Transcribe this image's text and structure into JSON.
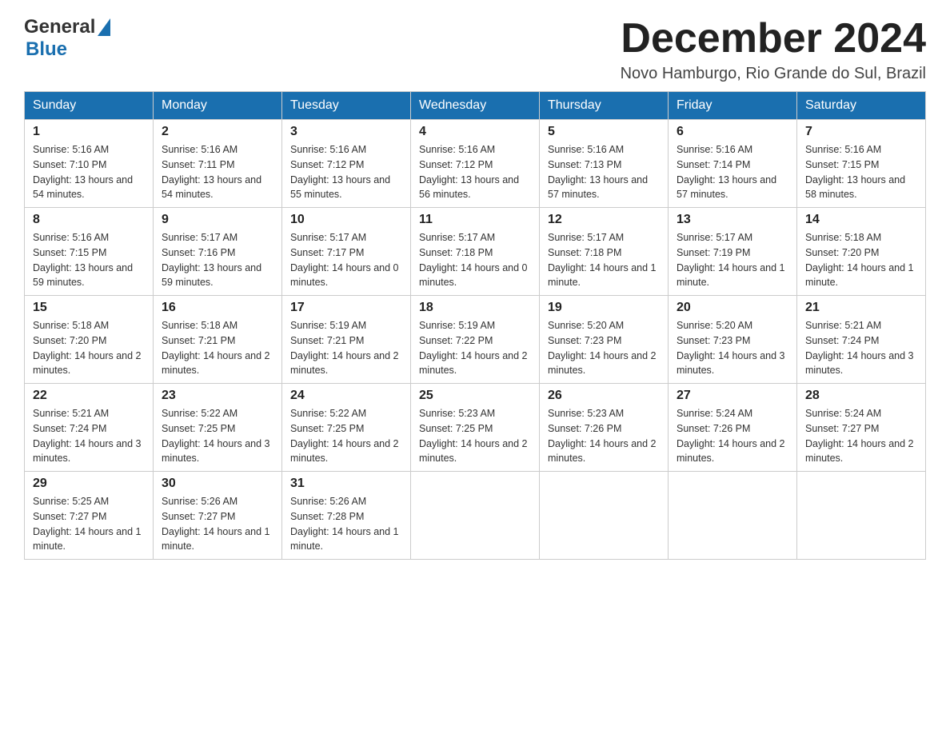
{
  "logo": {
    "text_general": "General",
    "text_blue": "Blue",
    "aria": "GeneralBlue logo"
  },
  "header": {
    "month_year": "December 2024",
    "location": "Novo Hamburgo, Rio Grande do Sul, Brazil"
  },
  "days_of_week": [
    "Sunday",
    "Monday",
    "Tuesday",
    "Wednesday",
    "Thursday",
    "Friday",
    "Saturday"
  ],
  "weeks": [
    [
      {
        "day": "1",
        "sunrise": "5:16 AM",
        "sunset": "7:10 PM",
        "daylight": "13 hours and 54 minutes."
      },
      {
        "day": "2",
        "sunrise": "5:16 AM",
        "sunset": "7:11 PM",
        "daylight": "13 hours and 54 minutes."
      },
      {
        "day": "3",
        "sunrise": "5:16 AM",
        "sunset": "7:12 PM",
        "daylight": "13 hours and 55 minutes."
      },
      {
        "day": "4",
        "sunrise": "5:16 AM",
        "sunset": "7:12 PM",
        "daylight": "13 hours and 56 minutes."
      },
      {
        "day": "5",
        "sunrise": "5:16 AM",
        "sunset": "7:13 PM",
        "daylight": "13 hours and 57 minutes."
      },
      {
        "day": "6",
        "sunrise": "5:16 AM",
        "sunset": "7:14 PM",
        "daylight": "13 hours and 57 minutes."
      },
      {
        "day": "7",
        "sunrise": "5:16 AM",
        "sunset": "7:15 PM",
        "daylight": "13 hours and 58 minutes."
      }
    ],
    [
      {
        "day": "8",
        "sunrise": "5:16 AM",
        "sunset": "7:15 PM",
        "daylight": "13 hours and 59 minutes."
      },
      {
        "day": "9",
        "sunrise": "5:17 AM",
        "sunset": "7:16 PM",
        "daylight": "13 hours and 59 minutes."
      },
      {
        "day": "10",
        "sunrise": "5:17 AM",
        "sunset": "7:17 PM",
        "daylight": "14 hours and 0 minutes."
      },
      {
        "day": "11",
        "sunrise": "5:17 AM",
        "sunset": "7:18 PM",
        "daylight": "14 hours and 0 minutes."
      },
      {
        "day": "12",
        "sunrise": "5:17 AM",
        "sunset": "7:18 PM",
        "daylight": "14 hours and 1 minute."
      },
      {
        "day": "13",
        "sunrise": "5:17 AM",
        "sunset": "7:19 PM",
        "daylight": "14 hours and 1 minute."
      },
      {
        "day": "14",
        "sunrise": "5:18 AM",
        "sunset": "7:20 PM",
        "daylight": "14 hours and 1 minute."
      }
    ],
    [
      {
        "day": "15",
        "sunrise": "5:18 AM",
        "sunset": "7:20 PM",
        "daylight": "14 hours and 2 minutes."
      },
      {
        "day": "16",
        "sunrise": "5:18 AM",
        "sunset": "7:21 PM",
        "daylight": "14 hours and 2 minutes."
      },
      {
        "day": "17",
        "sunrise": "5:19 AM",
        "sunset": "7:21 PM",
        "daylight": "14 hours and 2 minutes."
      },
      {
        "day": "18",
        "sunrise": "5:19 AM",
        "sunset": "7:22 PM",
        "daylight": "14 hours and 2 minutes."
      },
      {
        "day": "19",
        "sunrise": "5:20 AM",
        "sunset": "7:23 PM",
        "daylight": "14 hours and 2 minutes."
      },
      {
        "day": "20",
        "sunrise": "5:20 AM",
        "sunset": "7:23 PM",
        "daylight": "14 hours and 3 minutes."
      },
      {
        "day": "21",
        "sunrise": "5:21 AM",
        "sunset": "7:24 PM",
        "daylight": "14 hours and 3 minutes."
      }
    ],
    [
      {
        "day": "22",
        "sunrise": "5:21 AM",
        "sunset": "7:24 PM",
        "daylight": "14 hours and 3 minutes."
      },
      {
        "day": "23",
        "sunrise": "5:22 AM",
        "sunset": "7:25 PM",
        "daylight": "14 hours and 3 minutes."
      },
      {
        "day": "24",
        "sunrise": "5:22 AM",
        "sunset": "7:25 PM",
        "daylight": "14 hours and 2 minutes."
      },
      {
        "day": "25",
        "sunrise": "5:23 AM",
        "sunset": "7:25 PM",
        "daylight": "14 hours and 2 minutes."
      },
      {
        "day": "26",
        "sunrise": "5:23 AM",
        "sunset": "7:26 PM",
        "daylight": "14 hours and 2 minutes."
      },
      {
        "day": "27",
        "sunrise": "5:24 AM",
        "sunset": "7:26 PM",
        "daylight": "14 hours and 2 minutes."
      },
      {
        "day": "28",
        "sunrise": "5:24 AM",
        "sunset": "7:27 PM",
        "daylight": "14 hours and 2 minutes."
      }
    ],
    [
      {
        "day": "29",
        "sunrise": "5:25 AM",
        "sunset": "7:27 PM",
        "daylight": "14 hours and 1 minute."
      },
      {
        "day": "30",
        "sunrise": "5:26 AM",
        "sunset": "7:27 PM",
        "daylight": "14 hours and 1 minute."
      },
      {
        "day": "31",
        "sunrise": "5:26 AM",
        "sunset": "7:28 PM",
        "daylight": "14 hours and 1 minute."
      },
      null,
      null,
      null,
      null
    ]
  ],
  "labels": {
    "sunrise": "Sunrise:",
    "sunset": "Sunset:",
    "daylight": "Daylight:"
  }
}
